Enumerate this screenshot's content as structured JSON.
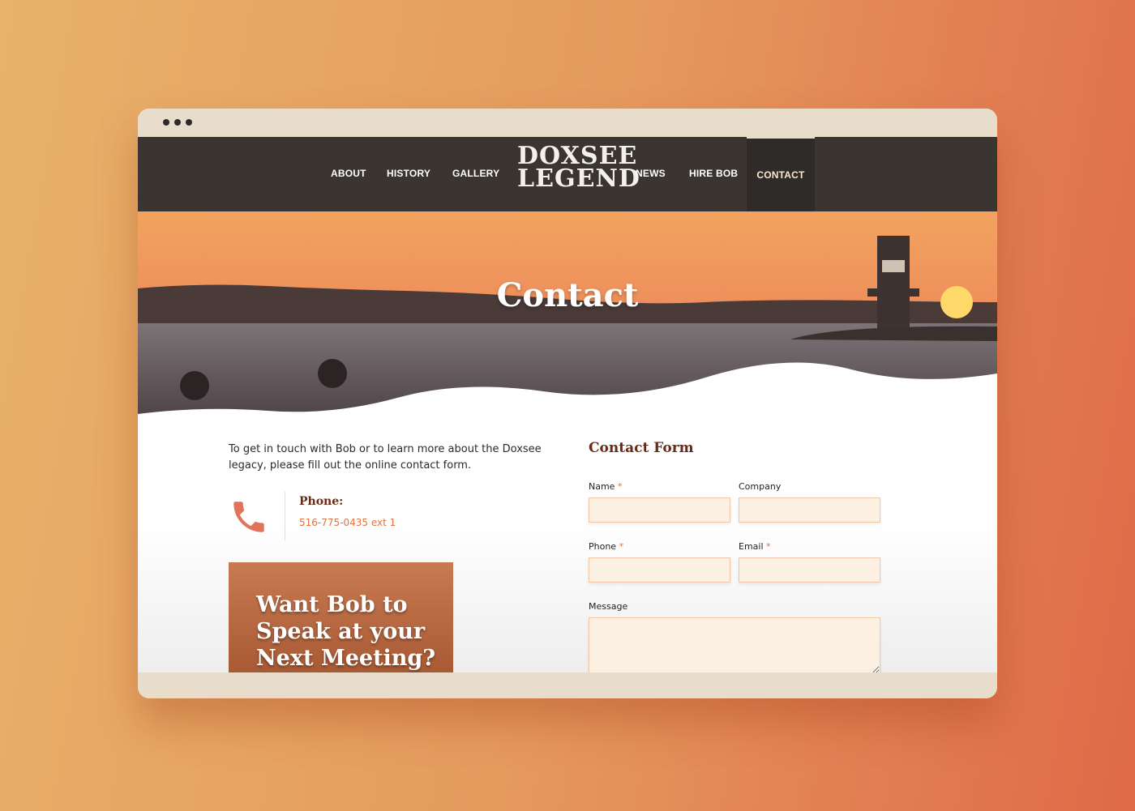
{
  "nav": {
    "items": [
      {
        "label": "ABOUT"
      },
      {
        "label": "HISTORY"
      },
      {
        "label": "GALLERY"
      },
      {
        "label": "NEWS"
      },
      {
        "label": "HIRE BOB"
      },
      {
        "label": "CONTACT",
        "active": true
      }
    ],
    "logo_line1": "DOXSEE",
    "logo_line2": "LEGEND"
  },
  "hero": {
    "title": "Contact"
  },
  "intro": "To get in touch with Bob or to learn more about the Doxsee legacy, please fill out the online contact form.",
  "phone": {
    "label": "Phone:",
    "number": "516-775-0435 ext 1",
    "icon": "phone-icon"
  },
  "promo": {
    "text": "Want Bob to Speak at your Next Meeting?"
  },
  "form": {
    "title": "Contact Form",
    "required_mark": "*",
    "fields": [
      {
        "label": "Name",
        "required": true,
        "value": ""
      },
      {
        "label": "Company",
        "required": false,
        "value": ""
      },
      {
        "label": "Phone",
        "required": true,
        "value": ""
      },
      {
        "label": "Email",
        "required": true,
        "value": ""
      },
      {
        "label": "Message",
        "required": false,
        "value": ""
      }
    ]
  },
  "colors": {
    "accent": "#e0733f",
    "heading": "#6a2a14",
    "nav_bg": "#3a3531",
    "input_bg": "#fcf0e2",
    "chrome": "#e8dccb"
  }
}
